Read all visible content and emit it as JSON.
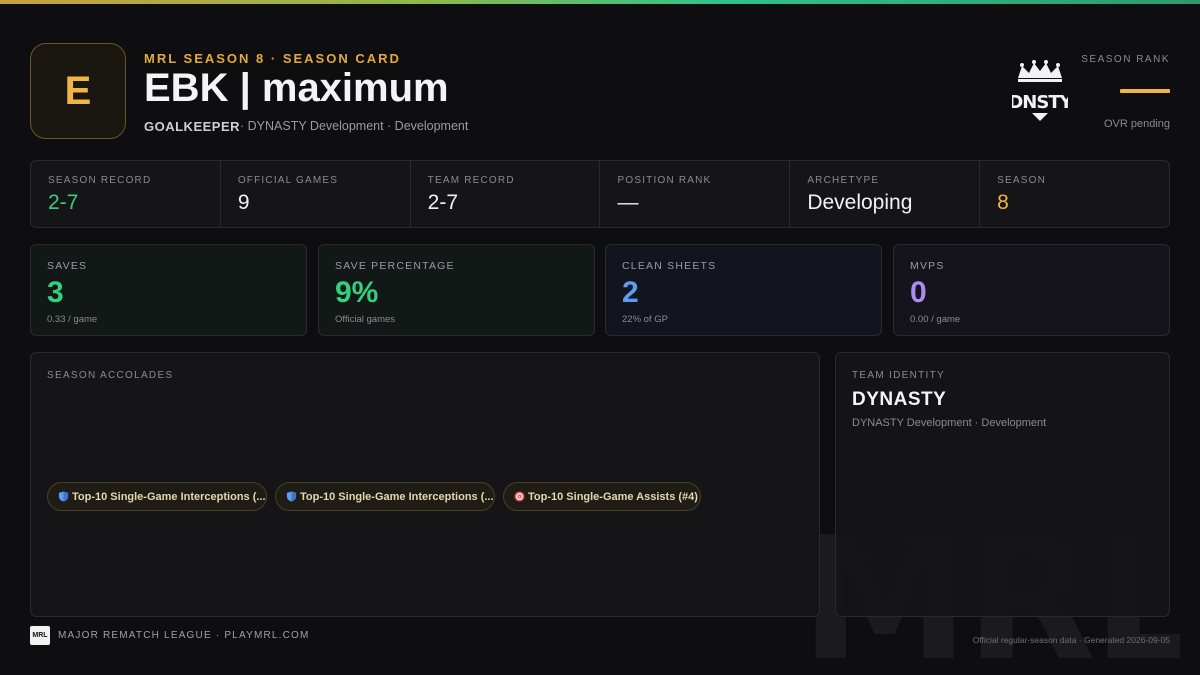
{
  "header": {
    "badge_letter": "E",
    "eyebrow": "MRL SEASON 8 · SEASON CARD",
    "player_name": "EBK | maximum",
    "position": "GOALKEEPER",
    "team_line": "· DYNASTY Development · Development",
    "team_logo_icon": "dnsty-crown-logo",
    "rank_label": "SEASON RANK",
    "rank_value": "—",
    "rank_sub": "OVR pending"
  },
  "strip": [
    {
      "label": "SEASON RECORD",
      "value": "2-7",
      "tone": "green"
    },
    {
      "label": "OFFICIAL GAMES",
      "value": "9",
      "tone": "white"
    },
    {
      "label": "TEAM RECORD",
      "value": "2-7",
      "tone": "white"
    },
    {
      "label": "POSITION RANK",
      "value": "—",
      "tone": "white"
    },
    {
      "label": "ARCHETYPE",
      "value": "Developing",
      "tone": "white"
    },
    {
      "label": "SEASON",
      "value": "8",
      "tone": "gold"
    }
  ],
  "cards": [
    {
      "label": "SAVES",
      "value": "3",
      "sub": "0.33 / game",
      "color": "#34d07f"
    },
    {
      "label": "SAVE PERCENTAGE",
      "value": "9%",
      "sub": "Official games",
      "color": "#34d07f"
    },
    {
      "label": "CLEAN SHEETS",
      "value": "2",
      "sub": "22% of GP",
      "color": "#5d9bf5"
    },
    {
      "label": "MVPS",
      "value": "0",
      "sub": "0.00 / game",
      "color": "#a98df0"
    }
  ],
  "accolades": {
    "label": "SEASON ACCOLADES",
    "items": [
      {
        "icon": "shield-icon",
        "text": "Top-10 Single-Game Interceptions (..."
      },
      {
        "icon": "shield-icon",
        "text": "Top-10 Single-Game Interceptions (..."
      },
      {
        "icon": "target-icon",
        "text": "Top-10 Single-Game Assists (#4)"
      }
    ]
  },
  "identity": {
    "label": "TEAM IDENTITY",
    "name": "DYNASTY",
    "sub": "DYNASTY Development · Development"
  },
  "footer": {
    "logo_text": "MRL",
    "text": "MAJOR REMATCH LEAGUE · PLAYMRL.COM",
    "right": "Official regular-season data · Generated 2026-09-05"
  },
  "watermark": "MRL"
}
